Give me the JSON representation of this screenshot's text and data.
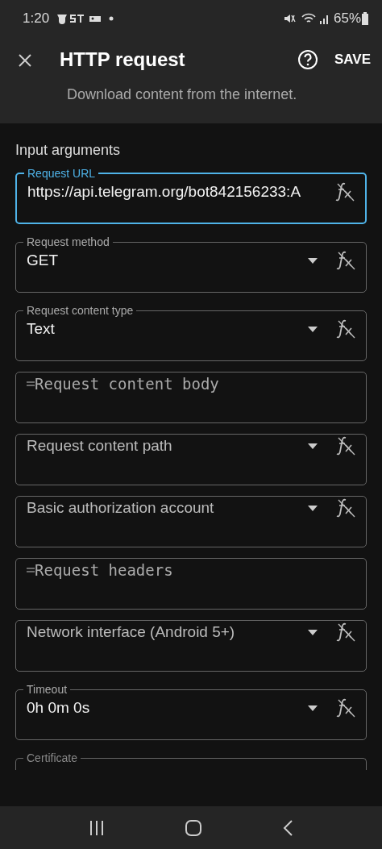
{
  "status_bar": {
    "time": "1:20",
    "battery": "65%"
  },
  "header": {
    "title": "HTTP request",
    "action": "SAVE",
    "subtitle": "Download content from the internet."
  },
  "section": {
    "title": "Input arguments"
  },
  "fields": [
    {
      "kind": "text",
      "label": "Request URL",
      "value": "https://api.telegram.org/bot842156233:A",
      "focused": true
    },
    {
      "kind": "select",
      "label": "Request method",
      "value": "GET",
      "focused": false
    },
    {
      "kind": "select",
      "label": "Request content type",
      "value": "Text",
      "focused": false
    },
    {
      "kind": "expression",
      "placeholder": "Request content body",
      "focused": false
    },
    {
      "kind": "select",
      "placeholder": "Request content path",
      "focused": false
    },
    {
      "kind": "select",
      "placeholder": "Basic authorization account",
      "focused": false
    },
    {
      "kind": "expression",
      "placeholder": "Request headers",
      "focused": false
    },
    {
      "kind": "select",
      "placeholder": "Network interface (Android 5+)",
      "focused": false
    },
    {
      "kind": "select",
      "label": "Timeout",
      "value": "0h 0m 0s",
      "focused": false
    },
    {
      "kind": "partial",
      "label": "Certificate",
      "focused": false
    }
  ]
}
